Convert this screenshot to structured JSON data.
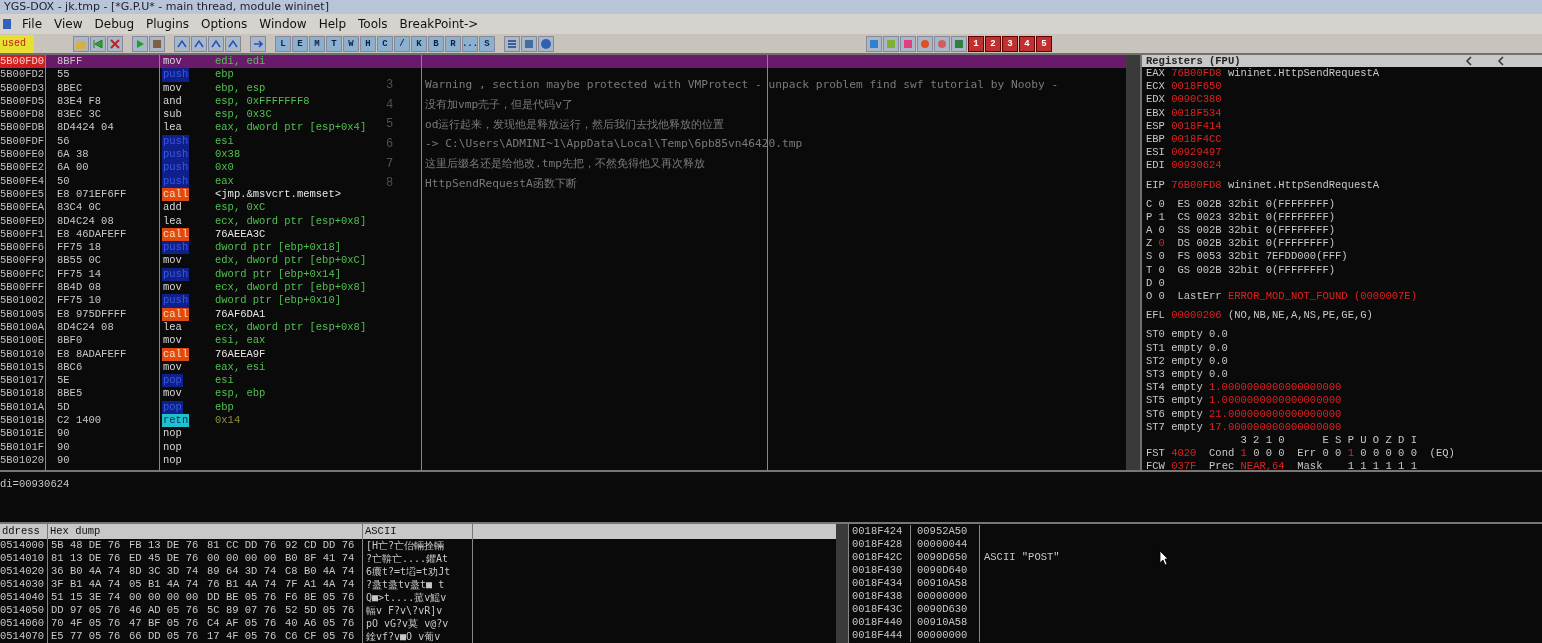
{
  "window": {
    "title": "YGS-DOX - jk.tmp - [*G.P.U* - main thread, module wininet]"
  },
  "menu": [
    "File",
    "View",
    "Debug",
    "Plugins",
    "Options",
    "Window",
    "Help",
    "Tools",
    "BreakPoint->"
  ],
  "toolbar": {
    "status": "used",
    "letters": [
      "L",
      "E",
      "M",
      "T",
      "W",
      "H",
      "C",
      "/",
      "K",
      "B",
      "R",
      "...",
      "S"
    ],
    "numbers": [
      "1",
      "2",
      "3",
      "4",
      "5"
    ]
  },
  "disassembly": [
    {
      "address": "5B00FD0",
      "hex": "8BFF",
      "mnemonic": "mov",
      "operand": "edi, edi",
      "kind": "plain",
      "selected": true
    },
    {
      "address": "5B00FD2",
      "hex": "55",
      "mnemonic": "push",
      "operand": "ebp",
      "kind": "stack",
      "selected": false
    },
    {
      "address": "5B00FD3",
      "hex": "8BEC",
      "mnemonic": "mov",
      "operand": "ebp, esp",
      "kind": "plain",
      "selected": false
    },
    {
      "address": "5B00FD5",
      "hex": "83E4 F8",
      "mnemonic": "and",
      "operand": "esp, 0xFFFFFFF8",
      "kind": "plain",
      "selected": false
    },
    {
      "address": "5B00FD8",
      "hex": "83EC 3C",
      "mnemonic": "sub",
      "operand": "esp, 0x3C",
      "kind": "plain",
      "selected": false
    },
    {
      "address": "5B00FDB",
      "hex": "8D4424 04",
      "mnemonic": "lea",
      "operand": "eax, dword ptr [esp+0x4]",
      "kind": "plain",
      "selected": false
    },
    {
      "address": "5B00FDF",
      "hex": "56",
      "mnemonic": "push",
      "operand": "esi",
      "kind": "stack",
      "selected": false
    },
    {
      "address": "5B00FE0",
      "hex": "6A 38",
      "mnemonic": "push",
      "operand": "0x38",
      "kind": "stack",
      "selected": false
    },
    {
      "address": "5B00FE2",
      "hex": "6A 00",
      "mnemonic": "push",
      "operand": "0x0",
      "kind": "stack",
      "selected": false
    },
    {
      "address": "5B00FE4",
      "hex": "50",
      "mnemonic": "push",
      "operand": "eax",
      "kind": "stack",
      "selected": false
    },
    {
      "address": "5B00FE5",
      "hex": "E8 071EF6FF",
      "mnemonic": "call",
      "operand": "<jmp.&msvcrt.memset>",
      "kind": "call",
      "selected": false
    },
    {
      "address": "5B00FEA",
      "hex": "83C4 0C",
      "mnemonic": "add",
      "operand": "esp, 0xC",
      "kind": "plain",
      "selected": false
    },
    {
      "address": "5B00FED",
      "hex": "8D4C24 08",
      "mnemonic": "lea",
      "operand": "ecx, dword ptr [esp+0x8]",
      "kind": "plain",
      "selected": false
    },
    {
      "address": "5B00FF1",
      "hex": "E8 46DAFEFF",
      "mnemonic": "call",
      "operand": "76AEEA3C",
      "kind": "call",
      "selected": false
    },
    {
      "address": "5B00FF6",
      "hex": "FF75 18",
      "mnemonic": "push",
      "operand": "dword ptr [ebp+0x18]",
      "kind": "stack",
      "selected": false
    },
    {
      "address": "5B00FF9",
      "hex": "8B55 0C",
      "mnemonic": "mov",
      "operand": "edx, dword ptr [ebp+0xC]",
      "kind": "plain",
      "selected": false
    },
    {
      "address": "5B00FFC",
      "hex": "FF75 14",
      "mnemonic": "push",
      "operand": "dword ptr [ebp+0x14]",
      "kind": "stack",
      "selected": false
    },
    {
      "address": "5B00FFF",
      "hex": "8B4D 08",
      "mnemonic": "mov",
      "operand": "ecx, dword ptr [ebp+0x8]",
      "kind": "plain",
      "selected": false
    },
    {
      "address": "5B01002",
      "hex": "FF75 10",
      "mnemonic": "push",
      "operand": "dword ptr [ebp+0x10]",
      "kind": "stack",
      "selected": false
    },
    {
      "address": "5B01005",
      "hex": "E8 975DFFFF",
      "mnemonic": "call",
      "operand": "76AF6DA1",
      "kind": "call",
      "selected": false
    },
    {
      "address": "5B0100A",
      "hex": "8D4C24 08",
      "mnemonic": "lea",
      "operand": "ecx, dword ptr [esp+0x8]",
      "kind": "plain",
      "selected": false
    },
    {
      "address": "5B0100E",
      "hex": "8BF0",
      "mnemonic": "mov",
      "operand": "esi, eax",
      "kind": "plain",
      "selected": false
    },
    {
      "address": "5B01010",
      "hex": "E8 8ADAFEFF",
      "mnemonic": "call",
      "operand": "76AEEA9F",
      "kind": "call",
      "selected": false
    },
    {
      "address": "5B01015",
      "hex": "8BC6",
      "mnemonic": "mov",
      "operand": "eax, esi",
      "kind": "plain",
      "selected": false
    },
    {
      "address": "5B01017",
      "hex": "5E",
      "mnemonic": "pop",
      "operand": "esi",
      "kind": "stack",
      "selected": false
    },
    {
      "address": "5B01018",
      "hex": "8BE5",
      "mnemonic": "mov",
      "operand": "esp, ebp",
      "kind": "plain",
      "selected": false
    },
    {
      "address": "5B0101A",
      "hex": "5D",
      "mnemonic": "pop",
      "operand": "ebp",
      "kind": "stack",
      "selected": false
    },
    {
      "address": "5B0101B",
      "hex": "C2 1400",
      "mnemonic": "retn",
      "operand": "0x14",
      "kind": "ret",
      "selected": false
    },
    {
      "address": "5B0101E",
      "hex": "90",
      "mnemonic": "nop",
      "kind": "plain",
      "selected": false
    },
    {
      "address": "5B0101F",
      "hex": "90",
      "mnemonic": "nop",
      "kind": "plain",
      "selected": false
    },
    {
      "address": "5B01020",
      "hex": "90",
      "mnemonic": "nop",
      "kind": "plain",
      "selected": false
    }
  ],
  "editor_overlay": [
    {
      "line": "3",
      "text": "Warning , section maybe protected with VMProtect - unpack problem  find swf tutorial by Nooby -"
    },
    {
      "line": "4",
      "text": "没有加vmp壳子，但是代码v了"
    },
    {
      "line": "5",
      "text": "od运行起来，发现他是释放运行，然后我们去找他释放的位置"
    },
    {
      "line": "6",
      "text": "-> C:\\Users\\ADMINI~1\\AppData\\Local\\Temp\\6pb85vn46420.tmp"
    },
    {
      "line": "7",
      "text": "这里后缀名还是给他改.tmp先把，不然免得他又再次释放"
    },
    {
      "line": "8",
      "text": "HttpSendRequestA函数下断"
    }
  ],
  "registers": {
    "title": "Registers (FPU)",
    "groups": [
      [
        [
          {
            "text": "EAX ",
            "changed": false
          },
          {
            "text": "76B00FD8",
            "changed": true
          },
          {
            "text": " wininet.HttpSendRequestA",
            "changed": false
          }
        ],
        [
          {
            "text": "ECX ",
            "changed": false
          },
          {
            "text": "0018F650",
            "changed": true
          }
        ],
        [
          {
            "text": "EDX ",
            "changed": false
          },
          {
            "text": "0090C380",
            "changed": true
          }
        ],
        [
          {
            "text": "EBX ",
            "changed": false
          },
          {
            "text": "0018F534",
            "changed": true
          }
        ],
        [
          {
            "text": "ESP ",
            "changed": false
          },
          {
            "text": "0018F414",
            "changed": true
          }
        ],
        [
          {
            "text": "EBP ",
            "changed": false
          },
          {
            "text": "0018F4CC",
            "changed": true
          }
        ],
        [
          {
            "text": "ESI ",
            "changed": false
          },
          {
            "text": "00929497",
            "changed": true
          }
        ],
        [
          {
            "text": "EDI ",
            "changed": false
          },
          {
            "text": "00930624",
            "changed": true
          }
        ]
      ],
      [
        [
          {
            "text": "EIP ",
            "changed": false
          },
          {
            "text": "76B00FD8",
            "changed": true
          },
          {
            "text": " wininet.HttpSendRequestA",
            "changed": false
          }
        ]
      ],
      [
        [
          {
            "text": "C 0  ES 002B 32bit 0(FFFFFFFF)",
            "changed": false
          }
        ],
        [
          {
            "text": "P 1  CS 0023 32bit 0(FFFFFFFF)",
            "changed": false
          }
        ],
        [
          {
            "text": "A 0  SS 002B 32bit 0(FFFFFFFF)",
            "changed": false
          }
        ],
        [
          {
            "text": "Z ",
            "changed": false
          },
          {
            "text": "0",
            "changed": true
          },
          {
            "text": "  DS 002B 32bit 0(FFFFFFFF)",
            "changed": false
          }
        ],
        [
          {
            "text": "S 0  FS 0053 32bit 7EFDD000(FFF)",
            "changed": false
          }
        ],
        [
          {
            "text": "T 0  GS 002B 32bit 0(FFFFFFFF)",
            "changed": false
          }
        ],
        [
          {
            "text": "D 0",
            "changed": false
          }
        ],
        [
          {
            "text": "O 0  LastErr ",
            "changed": false
          },
          {
            "text": "ERROR_MOD_NOT_FOUND (0000007E)",
            "changed": true
          }
        ]
      ],
      [
        [
          {
            "text": "EFL ",
            "changed": false
          },
          {
            "text": "00000206",
            "changed": true
          },
          {
            "text": " (NO,NB,NE,A,NS,PE,GE,G)",
            "changed": false
          }
        ]
      ],
      [
        [
          {
            "text": "ST0 empty 0.0",
            "changed": false
          }
        ],
        [
          {
            "text": "ST1 empty 0.0",
            "changed": false
          }
        ],
        [
          {
            "text": "ST2 empty 0.0",
            "changed": false
          }
        ],
        [
          {
            "text": "ST3 empty 0.0",
            "changed": false
          }
        ],
        [
          {
            "text": "ST4 empty ",
            "changed": false
          },
          {
            "text": "1.0000000000000000000",
            "changed": true
          }
        ],
        [
          {
            "text": "ST5 empty ",
            "changed": false
          },
          {
            "text": "1.0000000000000000000",
            "changed": true
          }
        ],
        [
          {
            "text": "ST6 empty ",
            "changed": false
          },
          {
            "text": "21.000000000000000000",
            "changed": true
          }
        ],
        [
          {
            "text": "ST7 empty ",
            "changed": false
          },
          {
            "text": "17.000000000000000000",
            "changed": true
          }
        ],
        [
          {
            "text": "               3 2 1 0      E S P U O Z D I",
            "changed": false
          }
        ],
        [
          {
            "text": "FST ",
            "changed": false
          },
          {
            "text": "4020",
            "changed": true
          },
          {
            "text": "  Cond ",
            "changed": false
          },
          {
            "text": "1",
            "changed": true
          },
          {
            "text": " 0 0 0  Err 0 0 ",
            "changed": false
          },
          {
            "text": "1",
            "changed": true
          },
          {
            "text": " 0 0 0 0 0  (EQ)",
            "changed": false
          }
        ],
        [
          {
            "text": "FCW ",
            "changed": false
          },
          {
            "text": "037F",
            "changed": true
          },
          {
            "text": "  Prec ",
            "changed": false
          },
          {
            "text": "NEAR,64",
            "changed": true
          },
          {
            "text": "  Mask    1 1 1 1 1 1",
            "changed": false
          }
        ]
      ]
    ]
  },
  "info_line": "di=00930624",
  "dump": {
    "columns": [
      "ddress",
      "Hex dump",
      "ASCII"
    ],
    "rows": [
      {
        "address": "0514000",
        "hex": [
          "5B 48 DE 76",
          "FB 13 DE 76",
          "81 CC DD 76",
          "92 CD DD 76"
        ],
        "ascii": "[H亡?亡佁輛拴輛"
      },
      {
        "address": "0514010",
        "hex": [
          "81 13 DE 76",
          "ED 45 DE 76",
          "00 00 00 00",
          "B0 8F 41 74"
        ],
        "ascii": "?亡鞥亡....鑺At"
      },
      {
        "address": "0514020",
        "hex": [
          "36 B0 4A 74",
          "8D 3C 3D 74",
          "89 64 3D 74",
          "C8 B0 4A 74"
        ],
        "ascii": "6癑t?=t塪=t劝Jt"
      },
      {
        "address": "0514030",
        "hex": [
          "3F B1 4A 74",
          "05 B1 4A 74",
          "76 B1 4A 74",
          "7F A1 4A 74"
        ],
        "ascii": "?盝t盝tv盝t■  t"
      },
      {
        "address": "0514040",
        "hex": [
          "51 15 3E 74",
          "00 00 00 00",
          "DD BE 05 76",
          "F6 8E 05 76"
        ],
        "ascii": "Q■>t....菰v鰩v"
      },
      {
        "address": "0514050",
        "hex": [
          "DD 97 05 76",
          "46 AD 05 76",
          "5C 89 07 76",
          "52 5D 05 76"
        ],
        "ascii": "輻v F?v\\?vR]v"
      },
      {
        "address": "0514060",
        "hex": [
          "70 4F 05 76",
          "47 BF 05 76",
          "C4 AF 05 76",
          "40 A6 05 76"
        ],
        "ascii": "pO vG?v莫 v@?v"
      },
      {
        "address": "0514070",
        "hex": [
          "E5 77 05 76",
          "66 DD 05 76",
          "17 4F 05 76",
          "C6 CF 05 76"
        ],
        "ascii": "鍂vf?v■O v葡v"
      }
    ]
  },
  "stack": [
    {
      "address": "0018F424",
      "value": "00952A50"
    },
    {
      "address": "0018F428",
      "value": "00000044"
    },
    {
      "address": "0018F42C",
      "value": "0090D650",
      "comment": "ASCII \"POST\""
    },
    {
      "address": "0018F430",
      "value": "0090D640"
    },
    {
      "address": "0018F434",
      "value": "00910A58"
    },
    {
      "address": "0018F438",
      "value": "00000000"
    },
    {
      "address": "0018F43C",
      "value": "0090D630"
    },
    {
      "address": "0018F440",
      "value": "00910A58"
    },
    {
      "address": "0018F444",
      "value": "00000000"
    }
  ]
}
